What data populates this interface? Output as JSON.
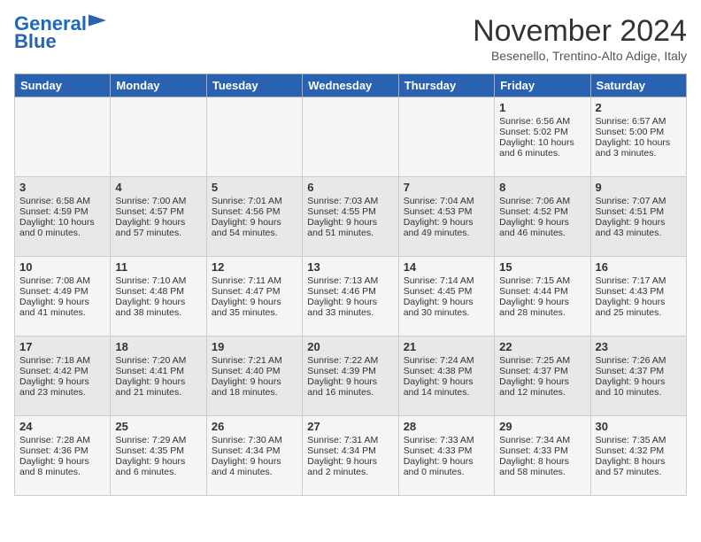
{
  "logo": {
    "line1": "General",
    "line2": "Blue"
  },
  "title": "November 2024",
  "location": "Besenello, Trentino-Alto Adige, Italy",
  "days_of_week": [
    "Sunday",
    "Monday",
    "Tuesday",
    "Wednesday",
    "Thursday",
    "Friday",
    "Saturday"
  ],
  "weeks": [
    [
      {
        "day": "",
        "info": ""
      },
      {
        "day": "",
        "info": ""
      },
      {
        "day": "",
        "info": ""
      },
      {
        "day": "",
        "info": ""
      },
      {
        "day": "",
        "info": ""
      },
      {
        "day": "1",
        "info": "Sunrise: 6:56 AM\nSunset: 5:02 PM\nDaylight: 10 hours and 6 minutes."
      },
      {
        "day": "2",
        "info": "Sunrise: 6:57 AM\nSunset: 5:00 PM\nDaylight: 10 hours and 3 minutes."
      }
    ],
    [
      {
        "day": "3",
        "info": "Sunrise: 6:58 AM\nSunset: 4:59 PM\nDaylight: 10 hours and 0 minutes."
      },
      {
        "day": "4",
        "info": "Sunrise: 7:00 AM\nSunset: 4:57 PM\nDaylight: 9 hours and 57 minutes."
      },
      {
        "day": "5",
        "info": "Sunrise: 7:01 AM\nSunset: 4:56 PM\nDaylight: 9 hours and 54 minutes."
      },
      {
        "day": "6",
        "info": "Sunrise: 7:03 AM\nSunset: 4:55 PM\nDaylight: 9 hours and 51 minutes."
      },
      {
        "day": "7",
        "info": "Sunrise: 7:04 AM\nSunset: 4:53 PM\nDaylight: 9 hours and 49 minutes."
      },
      {
        "day": "8",
        "info": "Sunrise: 7:06 AM\nSunset: 4:52 PM\nDaylight: 9 hours and 46 minutes."
      },
      {
        "day": "9",
        "info": "Sunrise: 7:07 AM\nSunset: 4:51 PM\nDaylight: 9 hours and 43 minutes."
      }
    ],
    [
      {
        "day": "10",
        "info": "Sunrise: 7:08 AM\nSunset: 4:49 PM\nDaylight: 9 hours and 41 minutes."
      },
      {
        "day": "11",
        "info": "Sunrise: 7:10 AM\nSunset: 4:48 PM\nDaylight: 9 hours and 38 minutes."
      },
      {
        "day": "12",
        "info": "Sunrise: 7:11 AM\nSunset: 4:47 PM\nDaylight: 9 hours and 35 minutes."
      },
      {
        "day": "13",
        "info": "Sunrise: 7:13 AM\nSunset: 4:46 PM\nDaylight: 9 hours and 33 minutes."
      },
      {
        "day": "14",
        "info": "Sunrise: 7:14 AM\nSunset: 4:45 PM\nDaylight: 9 hours and 30 minutes."
      },
      {
        "day": "15",
        "info": "Sunrise: 7:15 AM\nSunset: 4:44 PM\nDaylight: 9 hours and 28 minutes."
      },
      {
        "day": "16",
        "info": "Sunrise: 7:17 AM\nSunset: 4:43 PM\nDaylight: 9 hours and 25 minutes."
      }
    ],
    [
      {
        "day": "17",
        "info": "Sunrise: 7:18 AM\nSunset: 4:42 PM\nDaylight: 9 hours and 23 minutes."
      },
      {
        "day": "18",
        "info": "Sunrise: 7:20 AM\nSunset: 4:41 PM\nDaylight: 9 hours and 21 minutes."
      },
      {
        "day": "19",
        "info": "Sunrise: 7:21 AM\nSunset: 4:40 PM\nDaylight: 9 hours and 18 minutes."
      },
      {
        "day": "20",
        "info": "Sunrise: 7:22 AM\nSunset: 4:39 PM\nDaylight: 9 hours and 16 minutes."
      },
      {
        "day": "21",
        "info": "Sunrise: 7:24 AM\nSunset: 4:38 PM\nDaylight: 9 hours and 14 minutes."
      },
      {
        "day": "22",
        "info": "Sunrise: 7:25 AM\nSunset: 4:37 PM\nDaylight: 9 hours and 12 minutes."
      },
      {
        "day": "23",
        "info": "Sunrise: 7:26 AM\nSunset: 4:37 PM\nDaylight: 9 hours and 10 minutes."
      }
    ],
    [
      {
        "day": "24",
        "info": "Sunrise: 7:28 AM\nSunset: 4:36 PM\nDaylight: 9 hours and 8 minutes."
      },
      {
        "day": "25",
        "info": "Sunrise: 7:29 AM\nSunset: 4:35 PM\nDaylight: 9 hours and 6 minutes."
      },
      {
        "day": "26",
        "info": "Sunrise: 7:30 AM\nSunset: 4:34 PM\nDaylight: 9 hours and 4 minutes."
      },
      {
        "day": "27",
        "info": "Sunrise: 7:31 AM\nSunset: 4:34 PM\nDaylight: 9 hours and 2 minutes."
      },
      {
        "day": "28",
        "info": "Sunrise: 7:33 AM\nSunset: 4:33 PM\nDaylight: 9 hours and 0 minutes."
      },
      {
        "day": "29",
        "info": "Sunrise: 7:34 AM\nSunset: 4:33 PM\nDaylight: 8 hours and 58 minutes."
      },
      {
        "day": "30",
        "info": "Sunrise: 7:35 AM\nSunset: 4:32 PM\nDaylight: 8 hours and 57 minutes."
      }
    ]
  ]
}
